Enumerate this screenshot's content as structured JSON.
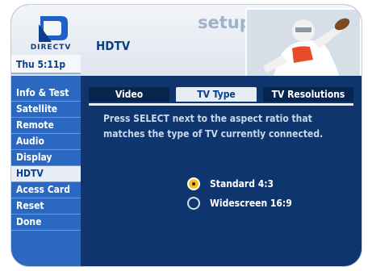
{
  "header": {
    "brand": "DIRECTV",
    "section_title": "setup",
    "page_title": "HDTV",
    "photo_icon": "football-player-image"
  },
  "sidebar": {
    "time": "Thu 5:11p",
    "items": [
      {
        "label": "Info & Test"
      },
      {
        "label": "Satellite"
      },
      {
        "label": "Remote"
      },
      {
        "label": "Audio"
      },
      {
        "label": "Display"
      },
      {
        "label": "HDTV",
        "active": true
      },
      {
        "label": "Acess Card"
      },
      {
        "label": "Reset"
      },
      {
        "label": "Done"
      }
    ]
  },
  "main": {
    "tabs": [
      {
        "label": "Video"
      },
      {
        "label": "TV Type",
        "active": true
      },
      {
        "label": "TV Resolutions"
      }
    ],
    "instruction": "Press SELECT next to the aspect ratio that matches the type of TV currently connected.",
    "options": [
      {
        "label": "Standard 4:3",
        "selected": true
      },
      {
        "label": "Widescreen 16:9",
        "selected": false
      }
    ]
  },
  "colors": {
    "accent_selected": "#f6c41a",
    "background": "#0f356e",
    "sidebar": "#2a68c2"
  }
}
